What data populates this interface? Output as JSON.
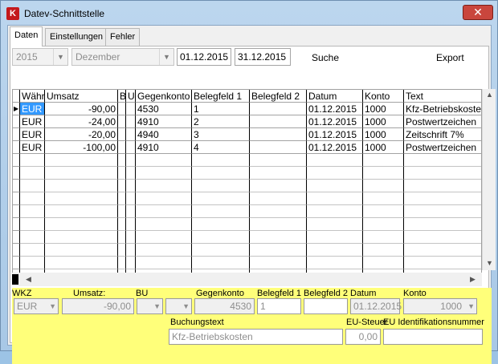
{
  "window": {
    "title": "Datev-Schnittstelle",
    "icon_letter": "K",
    "close_glyph": "✕"
  },
  "tabs": [
    {
      "label": "Daten",
      "active": true
    },
    {
      "label": "Einstellungen",
      "active": false
    },
    {
      "label": "Fehler",
      "active": false
    }
  ],
  "filters": {
    "year": "2015",
    "month": "Dezember",
    "date_from": "01.12.2015",
    "date_to": "31.12.2015",
    "search_label": "Suche",
    "export_label": "Export"
  },
  "grid": {
    "columns": [
      "Währ",
      "Umsatz",
      "B",
      "U",
      "Gegenkonto",
      "Belegfeld 1",
      "Belegfeld 2",
      "Datum",
      "Konto",
      "Text"
    ],
    "rows": [
      [
        "EUR",
        "-90,00",
        "",
        "",
        "4530",
        "1",
        "",
        "01.12.2015",
        "1000",
        "Kfz-Betriebskosten"
      ],
      [
        "EUR",
        "-24,00",
        "",
        "",
        "4910",
        "2",
        "",
        "01.12.2015",
        "1000",
        "Postwertzeichen"
      ],
      [
        "EUR",
        "-20,00",
        "",
        "",
        "4940",
        "3",
        "",
        "01.12.2015",
        "1000",
        "Zeitschrift 7%"
      ],
      [
        "EUR",
        "-100,00",
        "",
        "",
        "4910",
        "4",
        "",
        "01.12.2015",
        "1000",
        "Postwertzeichen"
      ]
    ],
    "empty_rows": 10
  },
  "detail": {
    "labels": {
      "wkz": "WKZ",
      "umsatz": "Umsatz:",
      "bu": "BU",
      "gegenkonto": "Gegenkonto",
      "belegfeld1": "Belegfeld 1",
      "belegfeld2": "Belegfeld 2",
      "datum": "Datum",
      "konto": "Konto",
      "buchungstext": "Buchungstext",
      "eu_steuer": "EU-Steuer",
      "eu_id": "EU Identifikationsnummer"
    },
    "values": {
      "wkz": "EUR",
      "umsatz": "-90,00",
      "bu": "",
      "gegenkonto": "4530",
      "belegfeld1": "1",
      "belegfeld2": "",
      "datum": "01.12.2015",
      "konto": "1000",
      "buchungstext": "Kfz-Betriebskosten",
      "eu_steuer": "0,00",
      "eu_id": ""
    }
  },
  "colors": {
    "detail_bg": "#ffff7a",
    "selection": "#3399ff"
  }
}
